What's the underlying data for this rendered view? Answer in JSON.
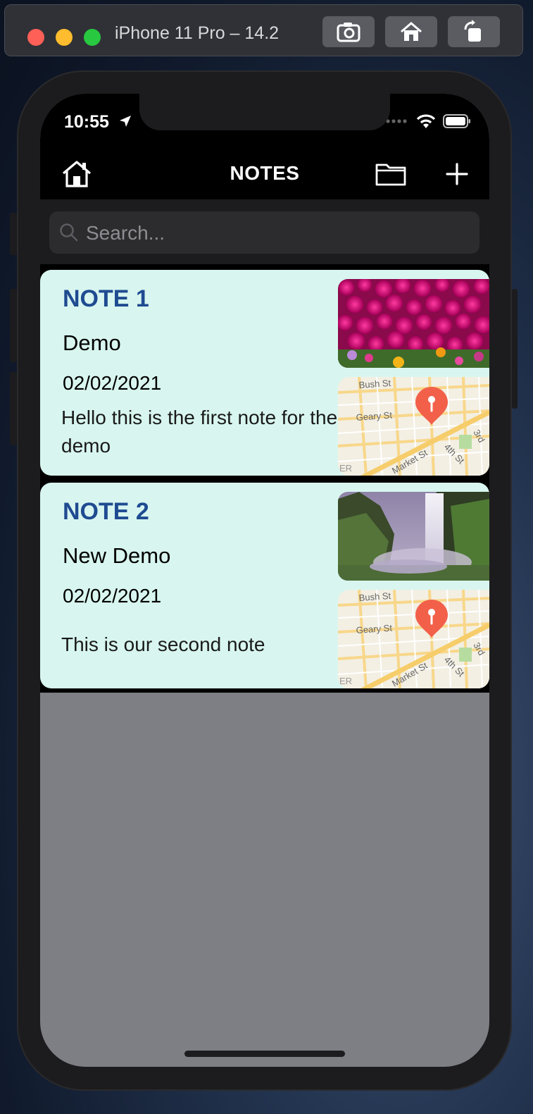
{
  "simulator": {
    "title": "iPhone 11 Pro – 14.2",
    "buttons": [
      "screenshot-icon",
      "home-icon",
      "rotate-icon"
    ]
  },
  "status_bar": {
    "time": "10:55"
  },
  "nav": {
    "title": "NOTES"
  },
  "search": {
    "placeholder": "Search..."
  },
  "notes": [
    {
      "title": "NOTE 1",
      "subtitle": "Demo",
      "date": "02/02/2021",
      "body": "Hello this is the first note for the demo",
      "photo": "flowers",
      "map_labels": [
        "Bush St",
        "Geary St",
        "Market St",
        "4th St",
        "3rd"
      ]
    },
    {
      "title": "NOTE 2",
      "subtitle": "New Demo",
      "date": "02/02/2021",
      "body": "This is our second note",
      "photo": "waterfall",
      "map_labels": [
        "Bush St",
        "Geary St",
        "Market St",
        "4th St",
        "3rd"
      ]
    }
  ],
  "colors": {
    "card_bg": "#d8f6ef",
    "note_title": "#1f4b91",
    "map_pin": "#f2604a",
    "screen_bg": "#7e7f84"
  }
}
